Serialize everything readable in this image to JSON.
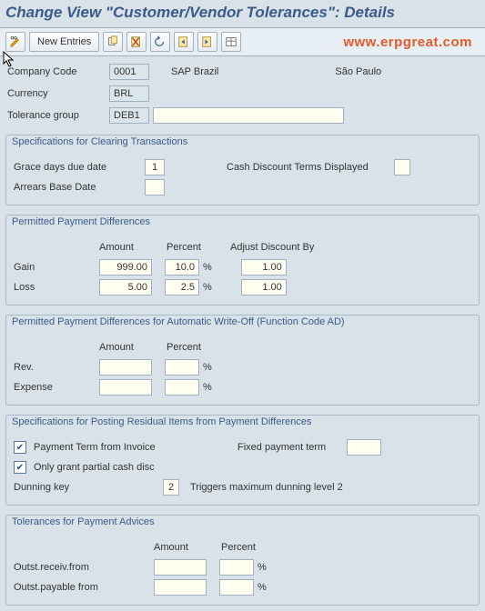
{
  "title": "Change View \"Customer/Vendor Tolerances\": Details",
  "watermark": "www.erpgreat.com",
  "toolbar": {
    "new_entries": "New Entries"
  },
  "header": {
    "company_code_lbl": "Company Code",
    "company_code": "0001",
    "company_name": "SAP Brazil",
    "company_city": "São Paulo",
    "currency_lbl": "Currency",
    "currency": "BRL",
    "tolerance_group_lbl": "Tolerance group",
    "tolerance_group": "DEB1",
    "tolerance_group_desc": ""
  },
  "spec_clearing": {
    "title": "Specifications for Clearing Transactions",
    "grace_days_lbl": "Grace days due date",
    "grace_days": "1",
    "cash_disc_lbl": "Cash Discount Terms Displayed",
    "cash_disc": "",
    "arrears_lbl": "Arrears Base Date",
    "arrears": ""
  },
  "ppd": {
    "title": "Permitted Payment Differences",
    "col_amount": "Amount",
    "col_percent": "Percent",
    "col_adjust": "Adjust Discount By",
    "gain_lbl": "Gain",
    "gain_amount": "999.00",
    "gain_percent": "10.0",
    "gain_adjust": "1.00",
    "loss_lbl": "Loss",
    "loss_amount": "5.00",
    "loss_percent": "2.5",
    "loss_adjust": "1.00",
    "pct_sign": "%"
  },
  "ppd_auto": {
    "title": "Permitted Payment Differences for Automatic Write-Off (Function Code AD)",
    "col_amount": "Amount",
    "col_percent": "Percent",
    "rev_lbl": "Rev.",
    "exp_lbl": "Expense",
    "pct_sign": "%"
  },
  "spec_residual": {
    "title": "Specifications for Posting Residual Items from Payment Differences",
    "pt_invoice": "Payment Term from Invoice",
    "fixed_pt_lbl": "Fixed payment term",
    "fixed_pt": "",
    "partial_cash": "Only grant partial cash disc",
    "dunning_lbl": "Dunning key",
    "dunning_key": "2",
    "dunning_desc": "Triggers maximum dunning level 2"
  },
  "tol_advices": {
    "title": "Tolerances for Payment Advices",
    "col_amount": "Amount",
    "col_percent": "Percent",
    "outst_recv_lbl": "Outst.receiv.from",
    "outst_pay_lbl": "Outst.payable from",
    "pct_sign": "%"
  }
}
